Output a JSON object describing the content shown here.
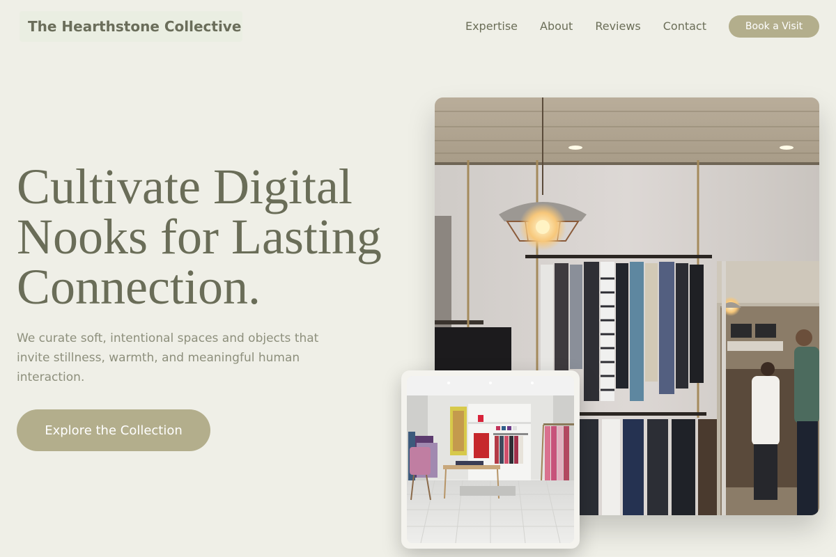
{
  "header": {
    "brand": "The Hearthstone Collective",
    "nav": [
      "Expertise",
      "About",
      "Reviews",
      "Contact"
    ],
    "cta_label": "Book a Visit"
  },
  "hero": {
    "title_lines": [
      "Cultivate Digital",
      "Nooks for Lasting",
      "Connection."
    ],
    "subtitle": "We curate soft, intentional spaces and objects that invite stillness, warmth, and meaningful human interaction.",
    "cta_label": "Explore the Collection"
  },
  "images": {
    "main": "boutique-interior-photo",
    "inset": "bright-clothing-store-photo"
  },
  "colors": {
    "background": "#efefe7",
    "accent": "#b3ae8c",
    "text": "#6a6d58",
    "muted_text": "#8d8f7c"
  }
}
